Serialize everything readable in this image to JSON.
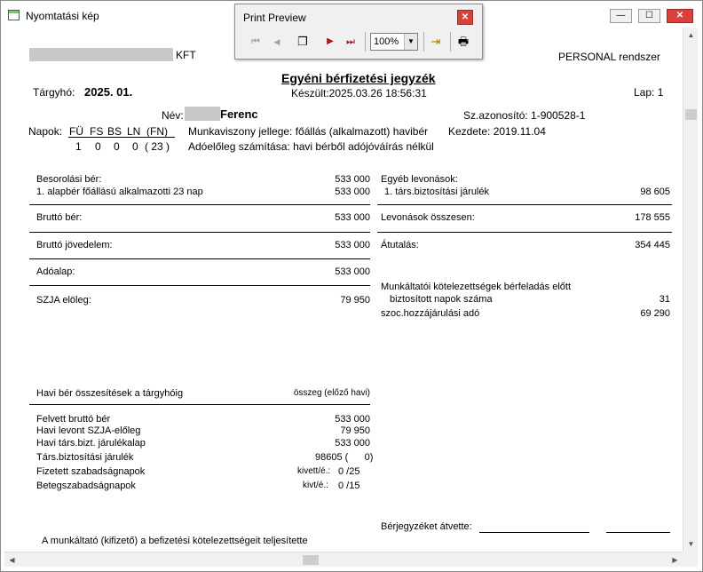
{
  "window": {
    "title": "Nyomtatási kép",
    "controls": {
      "minimize": "—",
      "maximize": "☐",
      "close": "✕"
    }
  },
  "print_preview": {
    "title": "Print Preview",
    "close": "✕",
    "buttons": {
      "first": "⏮",
      "prev": "◀",
      "pages": "❐",
      "next": "▶",
      "last": "⏭",
      "exit": "⇥",
      "print": "🖶"
    },
    "zoom": "100%"
  },
  "document": {
    "company_suffix": "KFT",
    "system": "PERSONAL rendszer",
    "title": "Egyéni bérfizetési jegyzék",
    "period_label": "Tárgyhó:",
    "period_value": "2025. 01.",
    "created": "Készült:2025.03.26 18:56:31",
    "page": "Lap:  1",
    "name_label": "Név:",
    "name_value": "Ferenc",
    "id_label": "Sz.azonosító: 1-900528-1",
    "days_label": "Napok:",
    "days_headers": [
      "FÜ",
      "FS",
      "BS",
      "LN",
      "(FN)"
    ],
    "days_values": [
      "1",
      "0",
      "0",
      "0",
      "( 23 )"
    ],
    "employment": "Munkaviszony jellege: főállás (alkalmazott) havibér",
    "start": "Kezdete: 2019.11.04",
    "tax_calc": "Adóelőleg számítása: havi bérből adójóváírás nélkül",
    "left_col": {
      "base_salary_label": "Besorolási bér:",
      "base_salary_value": "533 000",
      "base_item_label": "1. alapbér főállású alkalmazotti 23 nap",
      "base_item_value": "533 000",
      "gross_label": "Bruttó bér:",
      "gross_value": "533 000",
      "gross_income_label": "Bruttó jövedelem:",
      "gross_income_value": "533 000",
      "tax_base_label": "Adóalap:",
      "tax_base_value": "533 000",
      "szja_label": "SZJA elöleg:",
      "szja_value": "79 950"
    },
    "right_col": {
      "other_deductions_label": "Egyéb levonások:",
      "ssc_label": "1. társ.biztosítási járulék",
      "ssc_value": "98 605",
      "total_deductions_label": "Levonások összesen:",
      "total_deductions_value": "178 555",
      "transfer_label": "Átutalás:",
      "transfer_value": "354 445",
      "employer_title": "Munkáltatói kötelezettségek bérfeladás előtt",
      "insured_days_label": "biztosított napok száma",
      "insured_days_value": "31",
      "szocho_label": "szoc.hozzájárulási adó",
      "szocho_value": "69 290"
    },
    "summary": {
      "title": "Havi bér összesítések a tárgyhóig",
      "amount_header": "összeg (előző havi)",
      "rows": [
        {
          "label": "Felvett bruttó bér",
          "value": "533 000"
        },
        {
          "label": "Havi levont SZJA-előleg",
          "value": "79 950"
        },
        {
          "label": "Havi társ.bizt. járulékalap",
          "value": "533 000"
        },
        {
          "label": "Társ.biztosítási járulék",
          "value": "98605 (      0)"
        },
        {
          "label": "Fizetett szabadságnapok",
          "sub": "kivett/é.:",
          "value": "0 /25"
        },
        {
          "label": "Betegszabadságnapok",
          "sub": "kivt/é.:",
          "value": "0 /15"
        }
      ]
    },
    "footer_left": "A munkáltató (kifizető) a befizetési kötelezettségeit teljesítette",
    "footer_right": "Bérjegyzéket átvette:"
  }
}
